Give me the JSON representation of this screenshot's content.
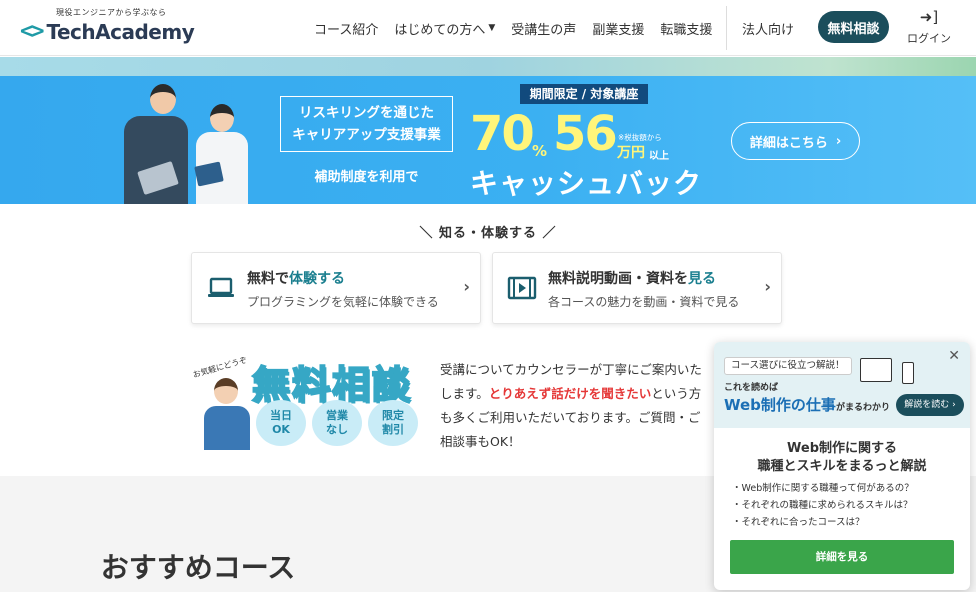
{
  "header": {
    "logo_tagline": "現役エンジニアから学ぶなら",
    "logo_mark": "<>",
    "logo_text": "TechAcademy",
    "nav": [
      {
        "label": "コース紹介"
      },
      {
        "label": "はじめての方へ"
      },
      {
        "label": "受講生の声"
      },
      {
        "label": "副業支援"
      },
      {
        "label": "転職支援"
      }
    ],
    "corporate": "法人向け",
    "consult_button": "無料相談",
    "login": "ログイン"
  },
  "banner": {
    "reskilling_line1": "リスキリングを通じた",
    "reskilling_line2": "キャリアアップ支援事業",
    "subsidy": "補助制度を利用で",
    "period": "期間限定 / 対象講座",
    "percent_value": "70",
    "percent_unit": "%",
    "amount_value": "56",
    "amount_unit": "万円",
    "tax_note": "※税抜額から",
    "above": "以上",
    "cashback": "キャッシュバック",
    "detail_button": "詳細はこちら"
  },
  "know": {
    "title": "＼ 知る・体験する ／",
    "cards": [
      {
        "title_pre": "無料で",
        "title_hl": "体験する",
        "title_post": "",
        "sub": "プログラミングを気軽に体験できる"
      },
      {
        "title_pre": "無料説明動画・資料を",
        "title_hl": "見る",
        "title_post": "",
        "sub": "各コースの魅力を動画・資料で見る"
      }
    ]
  },
  "consultation": {
    "okigaru": "お気軽にどうぞ",
    "title": "無料相談",
    "bubbles": [
      {
        "l1": "当日",
        "l2": "OK"
      },
      {
        "l1": "営業",
        "l2": "なし"
      },
      {
        "l1": "限定",
        "l2": "割引"
      }
    ],
    "text_1": "受講についてカウンセラーが丁寧にご案内いたします。",
    "text_red": "とりあえず話だけを聞きたい",
    "text_2": "という方も多くご利用いただいております。ご質問・ご相談事もOK！"
  },
  "recommended": {
    "title": "おすすめコース"
  },
  "popup": {
    "pill": "コース選びに役立つ解説！",
    "kore": "これを読めば",
    "web_title": "Web制作の仕事",
    "web_small": "がまるわかり",
    "kaisetsu_button": "解説を読む",
    "heading_line1": "Web制作に関する",
    "heading_line2": "職種とスキルをまるっと解説",
    "list": [
      "Web制作に関する職種って何があるの？",
      "それぞれの職種に求められるスキルは？",
      "それぞれに合ったコースは？"
    ],
    "cta": "詳細を見る"
  }
}
